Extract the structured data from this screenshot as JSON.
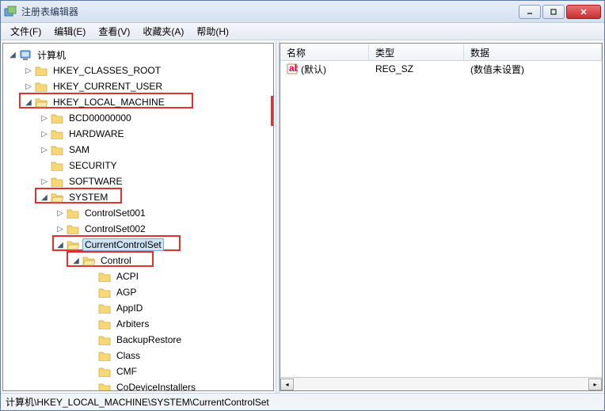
{
  "window": {
    "title": "注册表编辑器"
  },
  "menu": {
    "file": "文件(F)",
    "edit": "编辑(E)",
    "view": "查看(V)",
    "favorites": "收藏夹(A)",
    "help": "帮助(H)"
  },
  "tree": {
    "root": "计算机",
    "hkcr": "HKEY_CLASSES_ROOT",
    "hkcu": "HKEY_CURRENT_USER",
    "hklm": "HKEY_LOCAL_MACHINE",
    "bcd": "BCD00000000",
    "hardware": "HARDWARE",
    "sam": "SAM",
    "security": "SECURITY",
    "software": "SOFTWARE",
    "system": "SYSTEM",
    "cs001": "ControlSet001",
    "cs002": "ControlSet002",
    "ccs": "CurrentControlSet",
    "control": "Control",
    "acpi": "ACPI",
    "agp": "AGP",
    "appid": "AppID",
    "arbiters": "Arbiters",
    "backup": "BackupRestore",
    "class": "Class",
    "cmf": "CMF",
    "codev": "CoDeviceInstallers"
  },
  "list": {
    "columns": {
      "name": "名称",
      "type": "类型",
      "data": "数据"
    },
    "rows": [
      {
        "name": "(默认)",
        "type": "REG_SZ",
        "data": "(数值未设置)"
      }
    ]
  },
  "status": {
    "path": "计算机\\HKEY_LOCAL_MACHINE\\SYSTEM\\CurrentControlSet"
  }
}
